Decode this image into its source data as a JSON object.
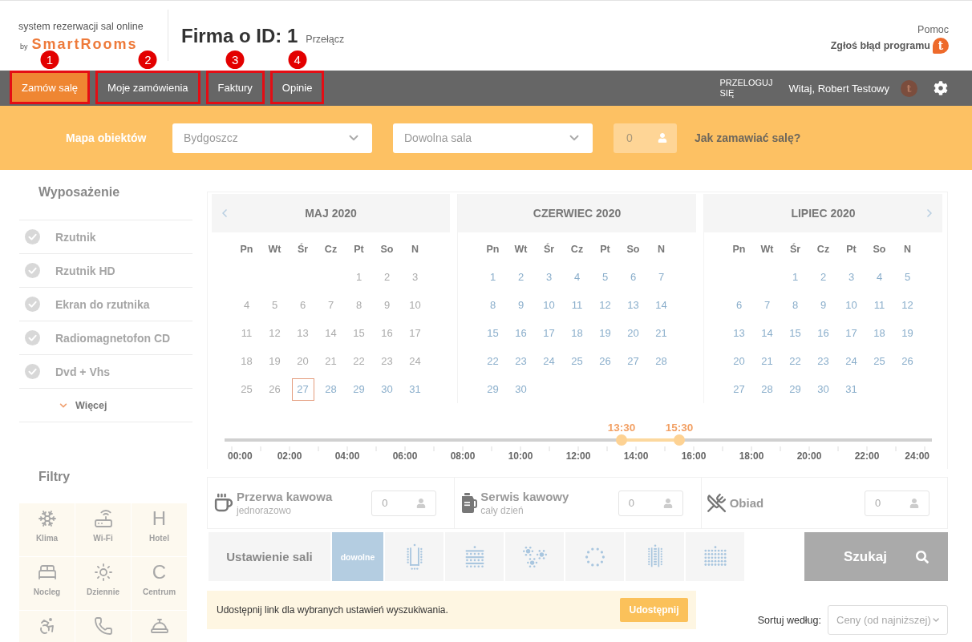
{
  "header": {
    "tagline": "system rezerwacji sal online",
    "by": "by",
    "brand": "SmartRooms",
    "company_title": "Firma o ID: 1",
    "switch_link": "Przełącz",
    "help_link": "Pomoc",
    "report_link": "Zgłoś błąd programu",
    "report_badge": "t"
  },
  "nav": {
    "tabs": [
      {
        "label": "Zamów salę",
        "selected": true,
        "highlighted": true,
        "marker": "1"
      },
      {
        "label": "Moje zamówienia",
        "selected": false,
        "highlighted": true,
        "marker": "2"
      },
      {
        "label": "Faktury",
        "selected": false,
        "highlighted": true,
        "marker": "3"
      },
      {
        "label": "Opinie",
        "selected": false,
        "highlighted": true,
        "marker": "4"
      }
    ],
    "relogin": "PRZELOGUJ SIĘ",
    "greeting": "Witaj, Robert Testowy",
    "avatar_badge": "t"
  },
  "search": {
    "map_link": "Mapa obiektów",
    "city_select": "Bydgoszcz",
    "room_select": "Dowolna sala",
    "people_field": "0",
    "help_link": "Jak zamawiać salę?"
  },
  "equipment": {
    "title": "Wyposażenie",
    "items": [
      {
        "label": "Rzutnik",
        "checked": false
      },
      {
        "label": "Rzutnik HD",
        "checked": false
      },
      {
        "label": "Ekran do rzutnika",
        "checked": false
      },
      {
        "label": "Radiomagnetofon CD",
        "checked": false
      },
      {
        "label": "Dvd + Vhs",
        "checked": false
      }
    ],
    "more": "Więcej"
  },
  "filters": {
    "title": "Filtry",
    "items": [
      {
        "label": "Klima",
        "selected": false
      },
      {
        "label": "Wi-Fi",
        "selected": false
      },
      {
        "glyph": "H",
        "label": "Hotel",
        "selected": false
      },
      {
        "label": "Nocleg",
        "selected": false
      },
      {
        "label": "Dziennie",
        "selected": false
      },
      {
        "glyph": "C",
        "label": "Centrum",
        "selected": false
      },
      {
        "selected": false
      },
      {
        "selected": false
      },
      {
        "selected": false
      }
    ]
  },
  "calendar": {
    "months": [
      {
        "title": "MAJ 2020",
        "weekdays": [
          "Pn",
          "Wt",
          "Śr",
          "Cz",
          "Pt",
          "So",
          "N"
        ],
        "weeks": [
          [
            {
              "day": "1",
              "disabled": true,
              "selected": false
            },
            {
              "day": "2",
              "disabled": true,
              "selected": false
            },
            {
              "day": "3",
              "disabled": true,
              "selected": false
            }
          ],
          [
            {
              "day": "4",
              "disabled": true,
              "selected": false
            },
            {
              "day": "5",
              "disabled": true,
              "selected": false
            },
            {
              "day": "6",
              "disabled": true,
              "selected": false
            },
            {
              "day": "7",
              "disabled": true,
              "selected": false
            },
            {
              "day": "8",
              "disabled": true,
              "selected": false
            },
            {
              "day": "9",
              "disabled": true,
              "selected": false
            },
            {
              "day": "10",
              "disabled": true,
              "selected": false
            }
          ],
          [
            {
              "day": "11",
              "disabled": true,
              "selected": false
            },
            {
              "day": "12",
              "disabled": true,
              "selected": false
            },
            {
              "day": "13",
              "disabled": true,
              "selected": false
            },
            {
              "day": "14",
              "disabled": true,
              "selected": false
            },
            {
              "day": "15",
              "disabled": true,
              "selected": false
            },
            {
              "day": "16",
              "disabled": true,
              "selected": false
            },
            {
              "day": "17",
              "disabled": true,
              "selected": false
            }
          ],
          [
            {
              "day": "18",
              "disabled": true,
              "selected": false
            },
            {
              "day": "19",
              "disabled": true,
              "selected": false
            },
            {
              "day": "20",
              "disabled": true,
              "selected": false
            },
            {
              "day": "21",
              "disabled": true,
              "selected": false
            },
            {
              "day": "22",
              "disabled": true,
              "selected": false
            },
            {
              "day": "23",
              "disabled": true,
              "selected": false
            },
            {
              "day": "24",
              "disabled": true,
              "selected": false
            }
          ],
          [
            {
              "day": "25",
              "disabled": true,
              "selected": false
            },
            {
              "day": "26",
              "disabled": true,
              "selected": false
            },
            {
              "day": "27",
              "disabled": false,
              "selected": true
            },
            {
              "day": "28",
              "disabled": false,
              "selected": false
            },
            {
              "day": "29",
              "disabled": false,
              "selected": false
            },
            {
              "day": "30",
              "disabled": false,
              "selected": false
            },
            {
              "day": "31",
              "disabled": false,
              "selected": false
            }
          ]
        ]
      },
      {
        "title": "CZERWIEC 2020",
        "weekdays": [
          "Pn",
          "Wt",
          "Śr",
          "Cz",
          "Pt",
          "So",
          "N"
        ],
        "weeks": [
          [
            {
              "day": "1",
              "disabled": false,
              "selected": false
            },
            {
              "day": "2",
              "disabled": false,
              "selected": false
            },
            {
              "day": "3",
              "disabled": false,
              "selected": false
            },
            {
              "day": "4",
              "disabled": false,
              "selected": false
            },
            {
              "day": "5",
              "disabled": false,
              "selected": false
            },
            {
              "day": "6",
              "disabled": false,
              "selected": false
            },
            {
              "day": "7",
              "disabled": false,
              "selected": false
            }
          ],
          [
            {
              "day": "8",
              "disabled": false,
              "selected": false
            },
            {
              "day": "9",
              "disabled": false,
              "selected": false
            },
            {
              "day": "10",
              "disabled": false,
              "selected": false
            },
            {
              "day": "11",
              "disabled": false,
              "selected": false
            },
            {
              "day": "12",
              "disabled": false,
              "selected": false
            },
            {
              "day": "13",
              "disabled": false,
              "selected": false
            },
            {
              "day": "14",
              "disabled": false,
              "selected": false
            }
          ],
          [
            {
              "day": "15",
              "disabled": false,
              "selected": false
            },
            {
              "day": "16",
              "disabled": false,
              "selected": false
            },
            {
              "day": "17",
              "disabled": false,
              "selected": false
            },
            {
              "day": "18",
              "disabled": false,
              "selected": false
            },
            {
              "day": "19",
              "disabled": false,
              "selected": false
            },
            {
              "day": "20",
              "disabled": false,
              "selected": false
            },
            {
              "day": "21",
              "disabled": false,
              "selected": false
            }
          ],
          [
            {
              "day": "22",
              "disabled": false,
              "selected": false
            },
            {
              "day": "23",
              "disabled": false,
              "selected": false
            },
            {
              "day": "24",
              "disabled": false,
              "selected": false
            },
            {
              "day": "25",
              "disabled": false,
              "selected": false
            },
            {
              "day": "26",
              "disabled": false,
              "selected": false
            },
            {
              "day": "27",
              "disabled": false,
              "selected": false
            },
            {
              "day": "28",
              "disabled": false,
              "selected": false
            }
          ],
          [
            {
              "day": "29",
              "disabled": false,
              "selected": false
            },
            {
              "day": "30",
              "disabled": false,
              "selected": false
            }
          ]
        ]
      },
      {
        "title": "LIPIEC 2020",
        "weekdays": [
          "Pn",
          "Wt",
          "Śr",
          "Cz",
          "Pt",
          "So",
          "N"
        ],
        "weeks": [
          [
            {
              "day": "1",
              "disabled": false,
              "selected": false
            },
            {
              "day": "2",
              "disabled": false,
              "selected": false
            },
            {
              "day": "3",
              "disabled": false,
              "selected": false
            },
            {
              "day": "4",
              "disabled": false,
              "selected": false
            },
            {
              "day": "5",
              "disabled": false,
              "selected": false
            }
          ],
          [
            {
              "day": "6",
              "disabled": false,
              "selected": false
            },
            {
              "day": "7",
              "disabled": false,
              "selected": false
            },
            {
              "day": "8",
              "disabled": false,
              "selected": false
            },
            {
              "day": "9",
              "disabled": false,
              "selected": false
            },
            {
              "day": "10",
              "disabled": false,
              "selected": false
            },
            {
              "day": "11",
              "disabled": false,
              "selected": false
            },
            {
              "day": "12",
              "disabled": false,
              "selected": false
            }
          ],
          [
            {
              "day": "13",
              "disabled": false,
              "selected": false
            },
            {
              "day": "14",
              "disabled": false,
              "selected": false
            },
            {
              "day": "15",
              "disabled": false,
              "selected": false
            },
            {
              "day": "16",
              "disabled": false,
              "selected": false
            },
            {
              "day": "17",
              "disabled": false,
              "selected": false
            },
            {
              "day": "18",
              "disabled": false,
              "selected": false
            },
            {
              "day": "19",
              "disabled": false,
              "selected": false
            }
          ],
          [
            {
              "day": "20",
              "disabled": false,
              "selected": false
            },
            {
              "day": "21",
              "disabled": false,
              "selected": false
            },
            {
              "day": "22",
              "disabled": false,
              "selected": false
            },
            {
              "day": "23",
              "disabled": false,
              "selected": false
            },
            {
              "day": "24",
              "disabled": false,
              "selected": false
            },
            {
              "day": "25",
              "disabled": false,
              "selected": false
            },
            {
              "day": "26",
              "disabled": false,
              "selected": false
            }
          ],
          [
            {
              "day": "27",
              "disabled": false,
              "selected": false
            },
            {
              "day": "28",
              "disabled": false,
              "selected": false
            },
            {
              "day": "29",
              "disabled": false,
              "selected": false
            },
            {
              "day": "30",
              "disabled": false,
              "selected": false
            },
            {
              "day": "31",
              "disabled": false,
              "selected": false
            }
          ]
        ]
      }
    ]
  },
  "time_range": {
    "handles": [
      {
        "label": "13:30",
        "level": 0.5625
      },
      {
        "label": "15:30",
        "level": 0.6458
      }
    ],
    "tick_labels": [
      "00:00",
      "02:00",
      "04:00",
      "06:00",
      "08:00",
      "10:00",
      "12:00",
      "14:00",
      "16:00",
      "18:00",
      "20:00",
      "22:00",
      "24:00"
    ]
  },
  "services": [
    {
      "title": "Przerwa kawowa",
      "subtitle": "jednorazowo",
      "people": "0"
    },
    {
      "title": "Serwis kawowy",
      "subtitle": "cały dzień",
      "people": "0"
    },
    {
      "title": "Obiad",
      "people": "0"
    }
  ],
  "room_setup": {
    "label": "Ustawienie sali",
    "options": [
      {
        "label": "dowolne",
        "selected": true
      },
      {
        "selected": false
      },
      {
        "selected": false
      },
      {
        "selected": false
      },
      {
        "selected": false
      },
      {
        "selected": false
      },
      {
        "selected": false
      }
    ]
  },
  "search_button": "Szukaj",
  "share": {
    "text": "Udostępnij link dla wybranych ustawień wyszukiwania.",
    "button": "Udostępnij"
  },
  "sort": {
    "label": "Sortuj według:",
    "value": "Ceny (od najniższej)"
  }
}
